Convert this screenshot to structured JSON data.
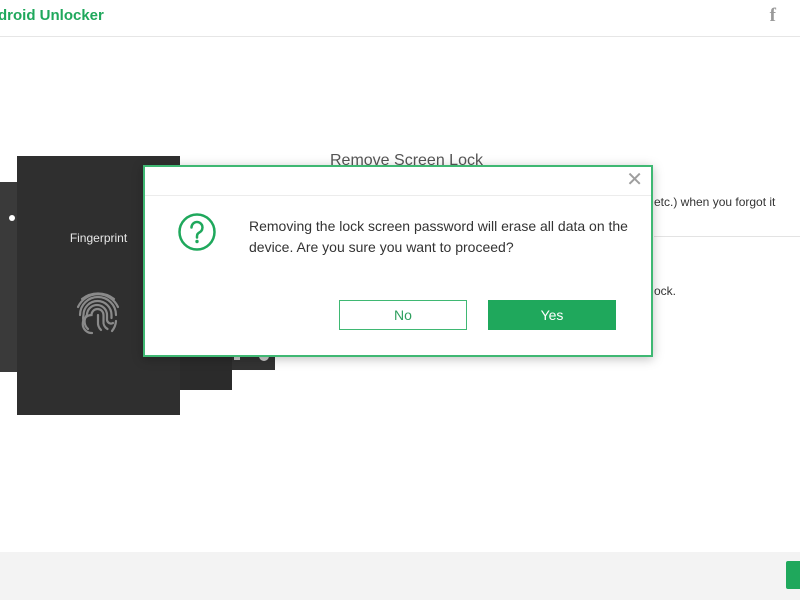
{
  "app": {
    "title": "droid Unlocker",
    "facebook_icon": "facebook-icon"
  },
  "background": {
    "heading": "Remove Screen Lock",
    "right_text": "etc.) when you forgot it",
    "right_text2": "ock."
  },
  "phone_card": {
    "label": "Fingerprint",
    "icon": "fingerprint-icon"
  },
  "dialog": {
    "message": "Removing the lock screen password will erase all data on the device. Are you sure you want to proceed?",
    "no_label": "No",
    "yes_label": "Yes",
    "close_glyph": "✕",
    "icon": "question-icon"
  },
  "colors": {
    "accent": "#1fa85c",
    "dialog_border": "#3fb873",
    "card": "#2f2f2f"
  }
}
